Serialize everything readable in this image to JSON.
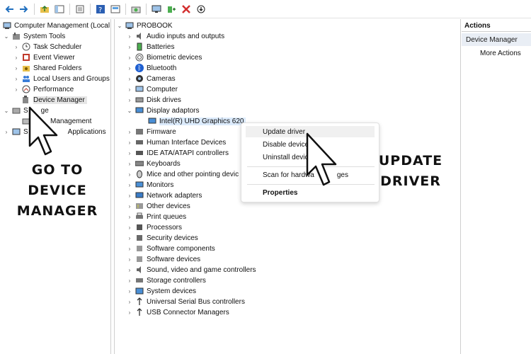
{
  "toolbar": {
    "icons": [
      "back-arrow-icon",
      "forward-arrow-icon",
      "up-folder-icon",
      "console-tree-icon",
      "properties-icon",
      "help-icon",
      "view-icon",
      "refresh-icon",
      "monitor-icon",
      "add-driver-icon",
      "uninstall-x-icon",
      "download-arrow-icon"
    ]
  },
  "left_tree": {
    "root": "Computer Management (Local",
    "system_tools": "System Tools",
    "items": [
      "Task Scheduler",
      "Event Viewer",
      "Shared Folders",
      "Local Users and Groups",
      "Performance",
      "Device Manager"
    ],
    "storage_partial": "S",
    "storage_suffix": "ge",
    "disk_management_suffix": "Management",
    "services_prefix": "S",
    "services_suffix": "Applications"
  },
  "device_tree": {
    "root": "PROBOOK",
    "categories_top": [
      "Audio inputs and outputs",
      "Batteries",
      "Biometric devices",
      "Bluetooth",
      "Cameras",
      "Computer",
      "Disk drives",
      "Display adaptors"
    ],
    "display_child": "Intel(R) UHD Graphics 620",
    "categories_bottom": [
      "Firmware",
      "Human Interface Devices",
      "IDE ATA/ATAPI controllers",
      "Keyboards",
      "Mice and other pointing devic",
      "Monitors",
      "Network adapters",
      "Other devices",
      "Print queues",
      "Processors",
      "Security devices",
      "Software components",
      "Software devices",
      "Sound, video and game controllers",
      "Storage controllers",
      "System devices",
      "Universal Serial Bus controllers",
      "USB Connector Managers"
    ]
  },
  "context_menu": {
    "update": "Update driver",
    "disable": "Disable device",
    "uninstall": "Uninstall devic",
    "scan_a": "Scan for hardwa",
    "scan_b": "ges",
    "properties": "Properties"
  },
  "actions": {
    "header": "Actions",
    "section": "Device Manager",
    "more": "More Actions"
  },
  "annotations": {
    "left_line1": "GO TO",
    "left_line2": "DEVICE",
    "left_line3": "MANAGER",
    "right": "UPDATE DRIVER"
  },
  "colors": {
    "selection": "#e6e6e6",
    "highlight": "#dcebfc",
    "action_band": "#e9eef5"
  }
}
